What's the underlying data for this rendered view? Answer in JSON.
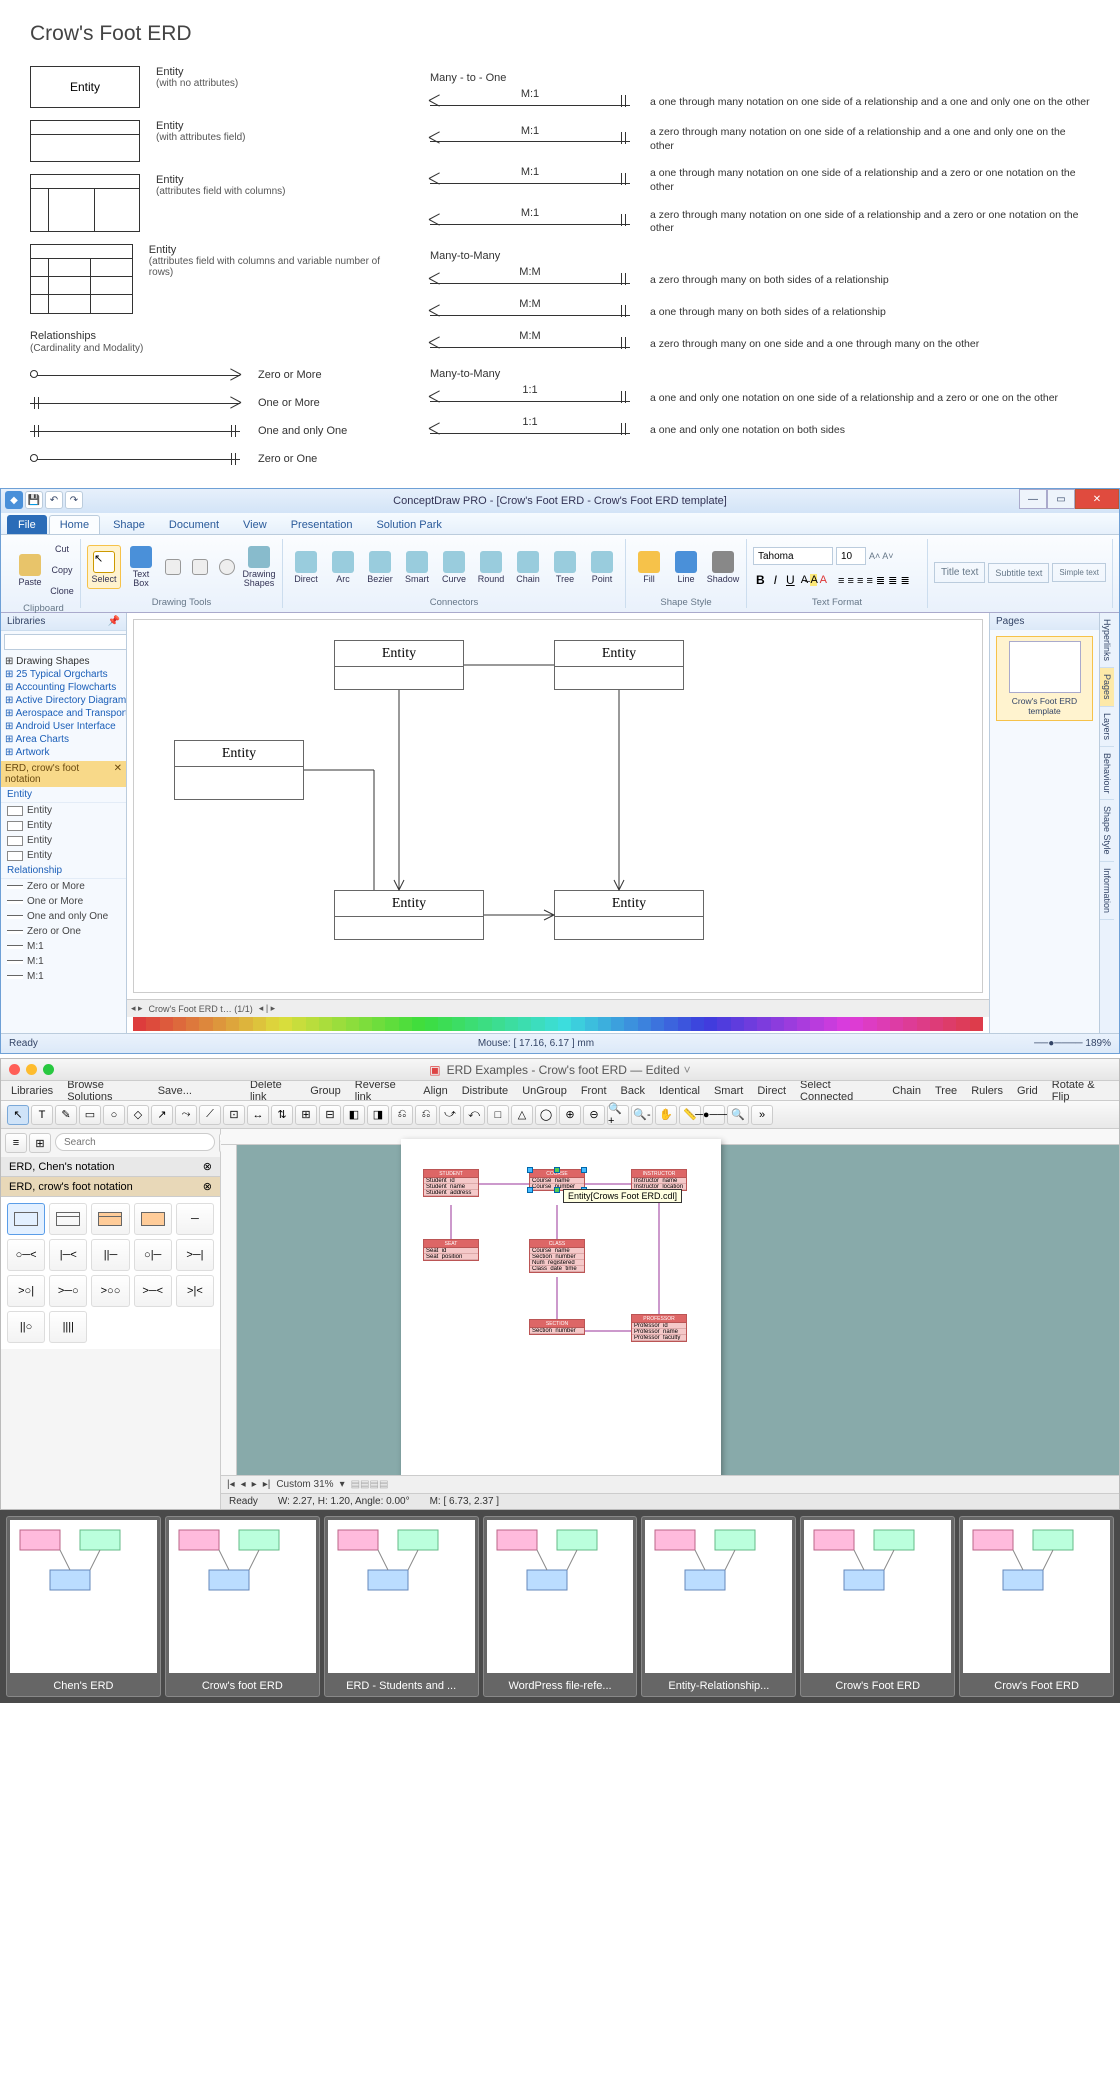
{
  "reference": {
    "title": "Crow's Foot ERD",
    "entities": [
      {
        "label": "Entity",
        "variant": "simple",
        "name": "Entity",
        "sub": "(with no attributes)"
      },
      {
        "label": "",
        "variant": "attr",
        "name": "Entity",
        "sub": "(with attributes field)"
      },
      {
        "label": "",
        "variant": "cols",
        "name": "Entity",
        "sub": "(attributes field with columns)"
      },
      {
        "label": "",
        "variant": "rows",
        "name": "Entity",
        "sub": "(attributes field with columns and variable number of rows)"
      }
    ],
    "relationships_title": "Relationships",
    "relationships_sub": "(Cardinality and Modality)",
    "cardinalities": [
      {
        "label": "Zero or More",
        "left": "circle",
        "right": "crow"
      },
      {
        "label": "One or More",
        "left": "bar",
        "right": "crow"
      },
      {
        "label": "One and only One",
        "left": "bar",
        "right": "bar"
      },
      {
        "label": "Zero or One",
        "left": "circle",
        "right": "bar"
      }
    ],
    "sections": [
      {
        "header": "Many - to - One",
        "lines": [
          {
            "ratio": "M:1",
            "desc": "a one through many notation on one side of a relationship and a one and only one on the other"
          },
          {
            "ratio": "M:1",
            "desc": "a zero through many notation on one side of a relationship and a one and only one on the other"
          },
          {
            "ratio": "M:1",
            "desc": "a one through many notation on one side of a relationship and a zero or one notation on the other"
          },
          {
            "ratio": "M:1",
            "desc": "a zero through many notation on one side of a relationship and a zero or one notation on the other"
          }
        ]
      },
      {
        "header": "Many-to-Many",
        "lines": [
          {
            "ratio": "M:M",
            "desc": "a zero through many on both sides of a relationship"
          },
          {
            "ratio": "M:M",
            "desc": "a one through many on both sides of a relationship"
          },
          {
            "ratio": "M:M",
            "desc": "a zero through many on one side and a one through many on the other"
          }
        ]
      },
      {
        "header": "Many-to-Many",
        "lines": [
          {
            "ratio": "1:1",
            "desc": "a one and only one notation on one side of a relationship and a zero or one on the other"
          },
          {
            "ratio": "1:1",
            "desc": "a one and only one notation on both sides"
          }
        ]
      }
    ]
  },
  "win": {
    "title": "ConceptDraw PRO - [Crow's Foot ERD - Crow's Foot ERD template]",
    "menu_tabs": [
      "File",
      "Home",
      "Shape",
      "Document",
      "View",
      "Presentation",
      "Solution Park"
    ],
    "active_tab": "Home",
    "ribbon_groups": [
      {
        "label": "Clipboard",
        "items": [
          "Paste",
          "Cut",
          "Copy",
          "Clone"
        ]
      },
      {
        "label": "Drawing Tools",
        "items": [
          "Select",
          "Text Box",
          "",
          "",
          "",
          "",
          "",
          "",
          "Drawing Shapes"
        ]
      },
      {
        "label": "Connectors",
        "items": [
          "Direct",
          "Arc",
          "Bezier",
          "Smart",
          "Curve",
          "Round",
          "Chain",
          "Tree",
          "Point"
        ]
      },
      {
        "label": "Shape Style",
        "items": [
          "Fill",
          "Line",
          "Shadow"
        ]
      },
      {
        "label": "Text Format",
        "items": []
      },
      {
        "label": "",
        "items": [
          "Title text",
          "Subtitle text",
          "Simple text"
        ]
      }
    ],
    "font_name": "Tahoma",
    "font_size": "10",
    "libraries_label": "Libraries",
    "tree": [
      "Drawing Shapes",
      "25 Typical Orgcharts",
      "Accounting Flowcharts",
      "Active Directory Diagrams",
      "Aerospace and Transport",
      "Android User Interface",
      "Area Charts",
      "Artwork"
    ],
    "stencil_header": "ERD, crow's foot notation",
    "stencil_cats": [
      "Entity",
      "Relationship"
    ],
    "stencil_entity_items": [
      "Entity",
      "Entity",
      "Entity",
      "Entity"
    ],
    "stencil_rel_items": [
      "Zero or More",
      "One or More",
      "One and only One",
      "Zero or One",
      "M:1",
      "M:1",
      "M:1"
    ],
    "canvas_entities": [
      "Entity",
      "Entity",
      "Entity",
      "Entity",
      "Entity"
    ],
    "pages_label": "Pages",
    "page_thumb": "Crow's Foot ERD template",
    "side_tabs": [
      "Hyperlinks",
      "Pages",
      "Layers",
      "Behaviour",
      "Shape Style",
      "Information"
    ],
    "tab_strip": "Crow's Foot ERD t… (1/1)",
    "status_ready": "Ready",
    "status_mouse": "Mouse: [ 17.16, 6.17 ] mm",
    "zoom": "189%"
  },
  "mac": {
    "title": "ERD Examples - Crow's foot ERD — Edited",
    "file_menu": [
      "Libraries",
      "Browse Solutions",
      "Save..."
    ],
    "menu": [
      "Delete link",
      "Group",
      "Reverse link",
      "Align",
      "Distribute",
      "UnGroup",
      "Front",
      "Back",
      "Identical",
      "Smart",
      "Direct",
      "Select Connected",
      "Chain",
      "Tree",
      "Rulers",
      "Grid",
      "Rotate & Flip"
    ],
    "search_placeholder": "Search",
    "stencil_tabs": [
      "ERD, Chen's notation",
      "ERD, crow's foot notation"
    ],
    "zoom_label": "Custom 31%",
    "status_wh": "W: 2.27,  H: 1.20,  Angle: 0.00°",
    "status_m": "M: [ 6.73, 2.37 ]",
    "status_ready": "Ready",
    "tooltip": "Entity[Crows Foot ERD.cdl]",
    "erd_entities": [
      {
        "name": "STUDENT",
        "rows": [
          "Student_id",
          "Student_name",
          "Student_address"
        ]
      },
      {
        "name": "COURSE",
        "rows": [
          "Course_name",
          "Course_number"
        ]
      },
      {
        "name": "INSTRUCTOR",
        "rows": [
          "Instructor_name",
          "Instructor_location"
        ]
      },
      {
        "name": "SEAT",
        "rows": [
          "Seat_id",
          "Seat_position"
        ]
      },
      {
        "name": "CLASS",
        "rows": [
          "Course_name",
          "Section_number",
          "Num_registered",
          "Class_date_time"
        ]
      },
      {
        "name": "SECTION",
        "rows": [
          "Section_number"
        ]
      },
      {
        "name": "PROFESSOR",
        "rows": [
          "Professor_id",
          "Professor_name",
          "Professor_faculty"
        ]
      }
    ]
  },
  "carousel": {
    "items": [
      "Chen's ERD",
      "Crow's foot ERD",
      "ERD - Students and ...",
      "WordPress file-refe...",
      "Entity-Relationship...",
      "Crow's Foot ERD",
      "Crow's Foot ERD"
    ]
  }
}
